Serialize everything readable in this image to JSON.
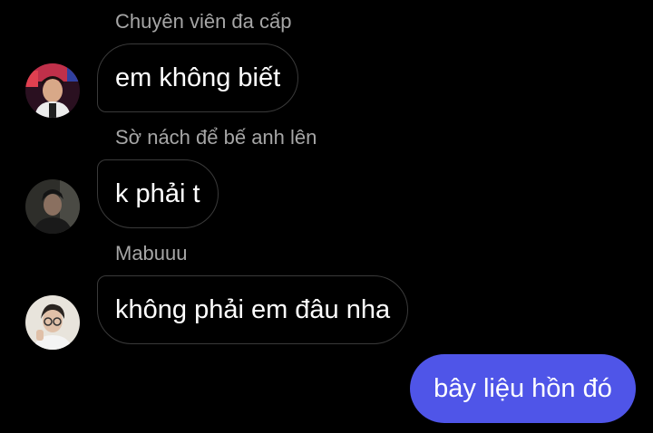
{
  "conversation": {
    "messages": [
      {
        "sender": "Chuyên viên đa cấp",
        "text": "em không biết",
        "avatar_icon": "user-avatar-icon"
      },
      {
        "sender": "Sờ nách để bế anh lên",
        "text": "k phải t",
        "avatar_icon": "user-avatar-icon"
      },
      {
        "sender": "Mabuuu",
        "text": "không phải em đâu nha",
        "avatar_icon": "user-avatar-icon"
      }
    ],
    "outgoing": {
      "text": "bây liệu hồn đó"
    }
  },
  "colors": {
    "background": "#000000",
    "sender_name": "#a6a6a6",
    "incoming_bubble_border": "#3a3a3a",
    "outgoing_bubble": "#4f55e8",
    "text": "#ffffff"
  }
}
